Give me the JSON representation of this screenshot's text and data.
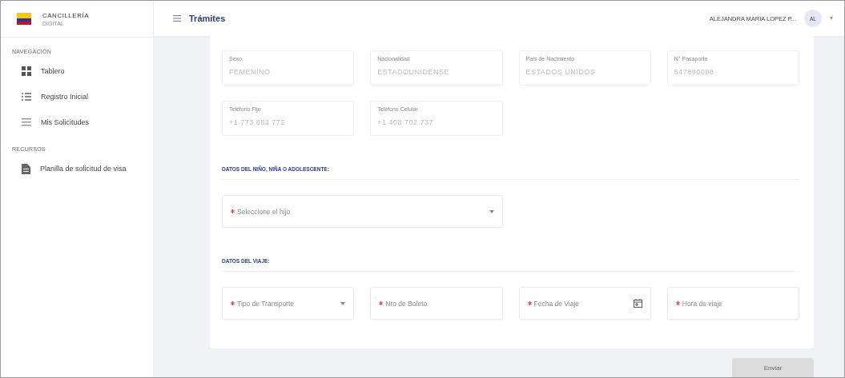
{
  "brand": {
    "name": "CANCILLERÍA",
    "subtitle": "DIGITAL"
  },
  "sidebar": {
    "sections": [
      {
        "title": "NAVEGACIÓN",
        "items": [
          {
            "label": "Tablero",
            "selected": false
          },
          {
            "label": "Registro Inicial",
            "selected": false
          },
          {
            "label": "Mis Solicitudes",
            "selected": false
          }
        ]
      },
      {
        "title": "RECURSOS",
        "items": [
          {
            "label": "Planilla de solicitud de visa",
            "selected": false
          }
        ]
      }
    ]
  },
  "header": {
    "title": "Trámites",
    "user": "ALEJANDRA MARIA LOPEZ P...",
    "avatar": "AL"
  },
  "form": {
    "readonly_fields": [
      {
        "label": "Sexo",
        "value": "FEMENINO"
      },
      {
        "label": "Nacionalidad",
        "value": "ESTADOUNIDENSE"
      },
      {
        "label": "País de Nacimiento",
        "value": "ESTADOS UNIDOS"
      },
      {
        "label": "N° Pasaporte",
        "value": "547890098"
      },
      {
        "label": "Teléfono Fijo",
        "value": "+1 773 883 772"
      },
      {
        "label": "Teléfono Celular",
        "value": "+1 403 702 737"
      }
    ],
    "sections": [
      {
        "title": "DATOS DEL NIÑO, NIÑA O ADOLESCENTE:",
        "fields": [
          {
            "kind": "select",
            "placeholder": "Seleccione el hijo",
            "required": true
          }
        ]
      },
      {
        "title": "DATOS DEL VIAJE:",
        "fields": [
          {
            "kind": "select",
            "placeholder": "Tipo de Transporte",
            "required": true
          },
          {
            "kind": "text",
            "placeholder": "Nro de Boleto",
            "required": true
          },
          {
            "kind": "date",
            "placeholder": "Fecha de Viaje",
            "required": true
          },
          {
            "kind": "text",
            "placeholder": "Hora de viaje",
            "required": true
          }
        ]
      }
    ]
  },
  "submit": {
    "label": "Enviar",
    "disabled": true
  }
}
